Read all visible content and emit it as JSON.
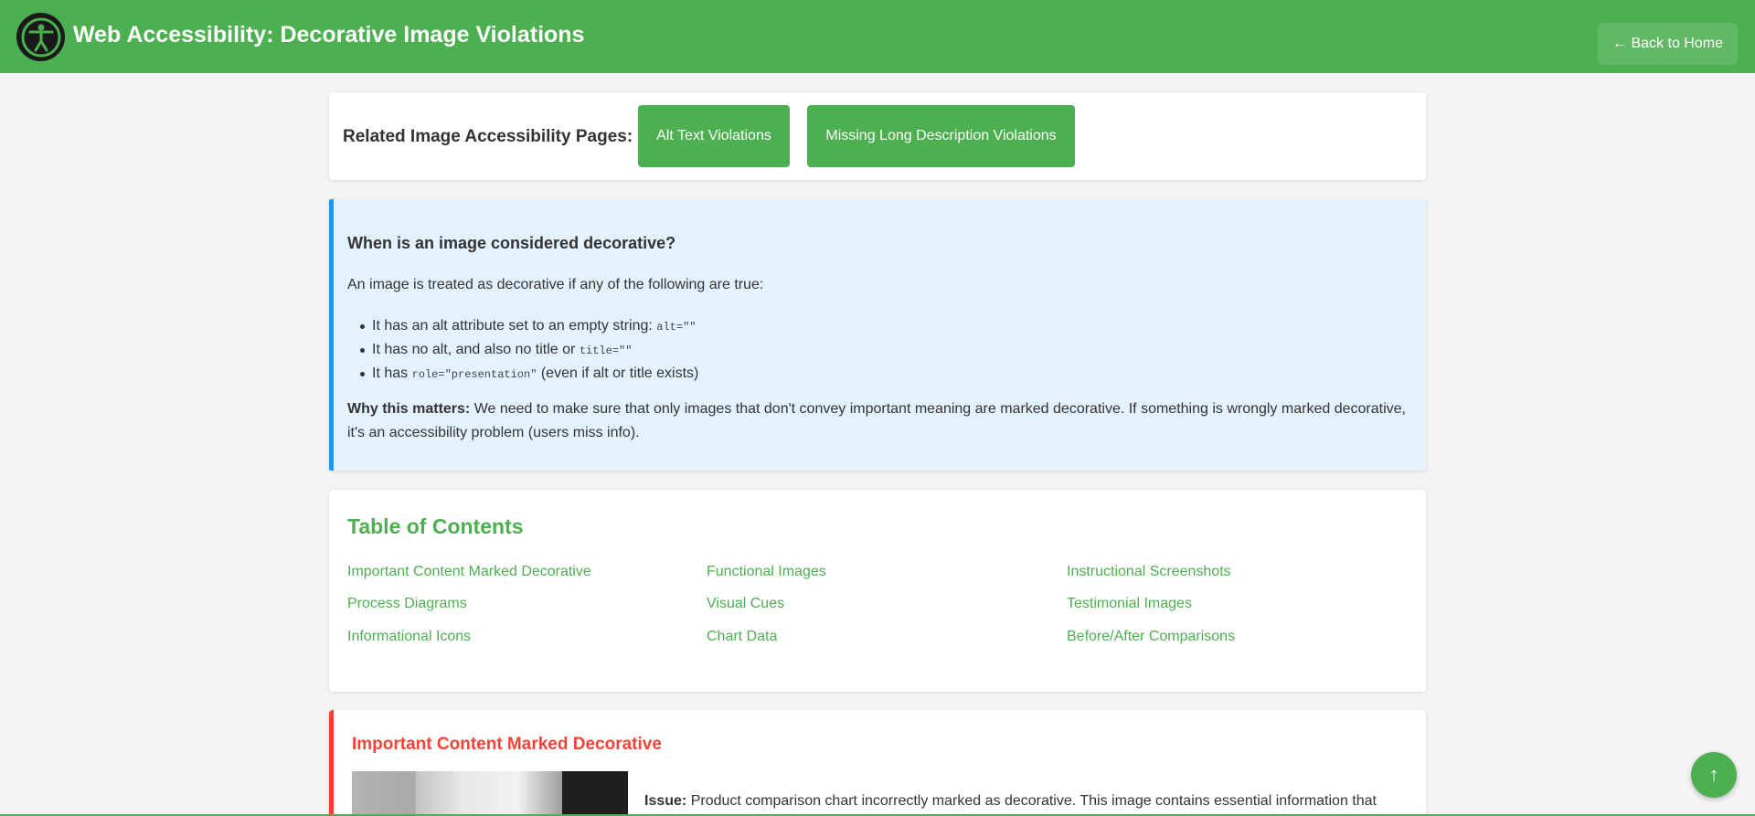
{
  "header": {
    "title": "Web Accessibility: Decorative Image Violations",
    "back_label": "← Back to Home",
    "logo_icon": "accessibility-icon"
  },
  "related": {
    "label": "Related Image Accessibility Pages:",
    "links": [
      "Alt Text Violations",
      "Missing Long Description Violations"
    ]
  },
  "info": {
    "heading": "When is an image considered decorative?",
    "intro": "An image is treated as decorative if any of the following are true:",
    "rules": [
      {
        "text": "It has an alt attribute set to an empty string: ",
        "code": "alt=\"\"",
        "suffix": ""
      },
      {
        "text": "It has no alt, and also no title or ",
        "code": "title=\"\"",
        "suffix": ""
      },
      {
        "text": "It has ",
        "code": "role=\"presentation\"",
        "suffix": " (even if alt or title exists)"
      }
    ],
    "why_label": "Why this matters:",
    "why_text": " We need to make sure that only images that don't convey important meaning are marked decorative. If something is wrongly marked decorative, it's an accessibility problem (users miss info)."
  },
  "toc": {
    "heading": "Table of Contents",
    "items": [
      "Important Content Marked Decorative",
      "Functional Images",
      "Instructional Screenshots",
      "Process Diagrams",
      "Visual Cues",
      "Testimonial Images",
      "Informational Icons",
      "Chart Data",
      "Before/After Comparisons"
    ]
  },
  "violation": {
    "heading": "Important Content Marked Decorative",
    "issue_label": "Issue:",
    "issue_text": " Product comparison chart incorrectly marked as decorative. This image contains essential information that"
  },
  "fab": {
    "label": "↑"
  },
  "colors": {
    "accent": "#4caf50",
    "info_border": "#2196f3",
    "info_bg": "#e3f2fd",
    "error": "#f44336"
  }
}
